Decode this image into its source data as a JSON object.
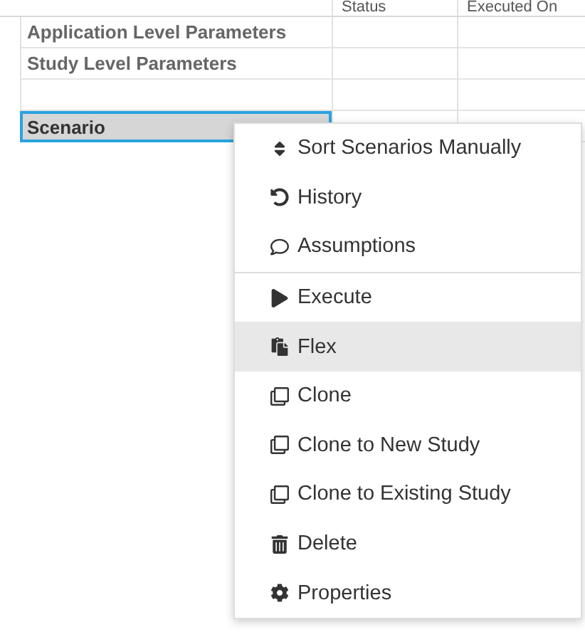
{
  "table": {
    "columns": [
      {
        "label": "Status"
      },
      {
        "label": "Executed On"
      }
    ],
    "rows": [
      {
        "label": "Application Level Parameters",
        "selected": false
      },
      {
        "label": "Study Level Parameters",
        "selected": false
      },
      {
        "selected": false
      },
      {
        "label": "Scenario",
        "selected": true
      }
    ]
  },
  "context_menu": {
    "groups": [
      [
        {
          "label": "Sort Scenarios Manually",
          "selected": false
        },
        {
          "label": "History",
          "selected": false
        },
        {
          "label": "Assumptions",
          "selected": false
        }
      ],
      [
        {
          "label": "Execute",
          "selected": false
        },
        {
          "label": "Flex",
          "selected": true
        },
        {
          "label": "Clone",
          "selected": false
        },
        {
          "label": "Clone to New Study",
          "selected": false
        },
        {
          "label": "Clone to Existing Study",
          "selected": false
        },
        {
          "label": "Delete",
          "selected": false
        },
        {
          "label": "Properties",
          "selected": false
        }
      ]
    ]
  }
}
